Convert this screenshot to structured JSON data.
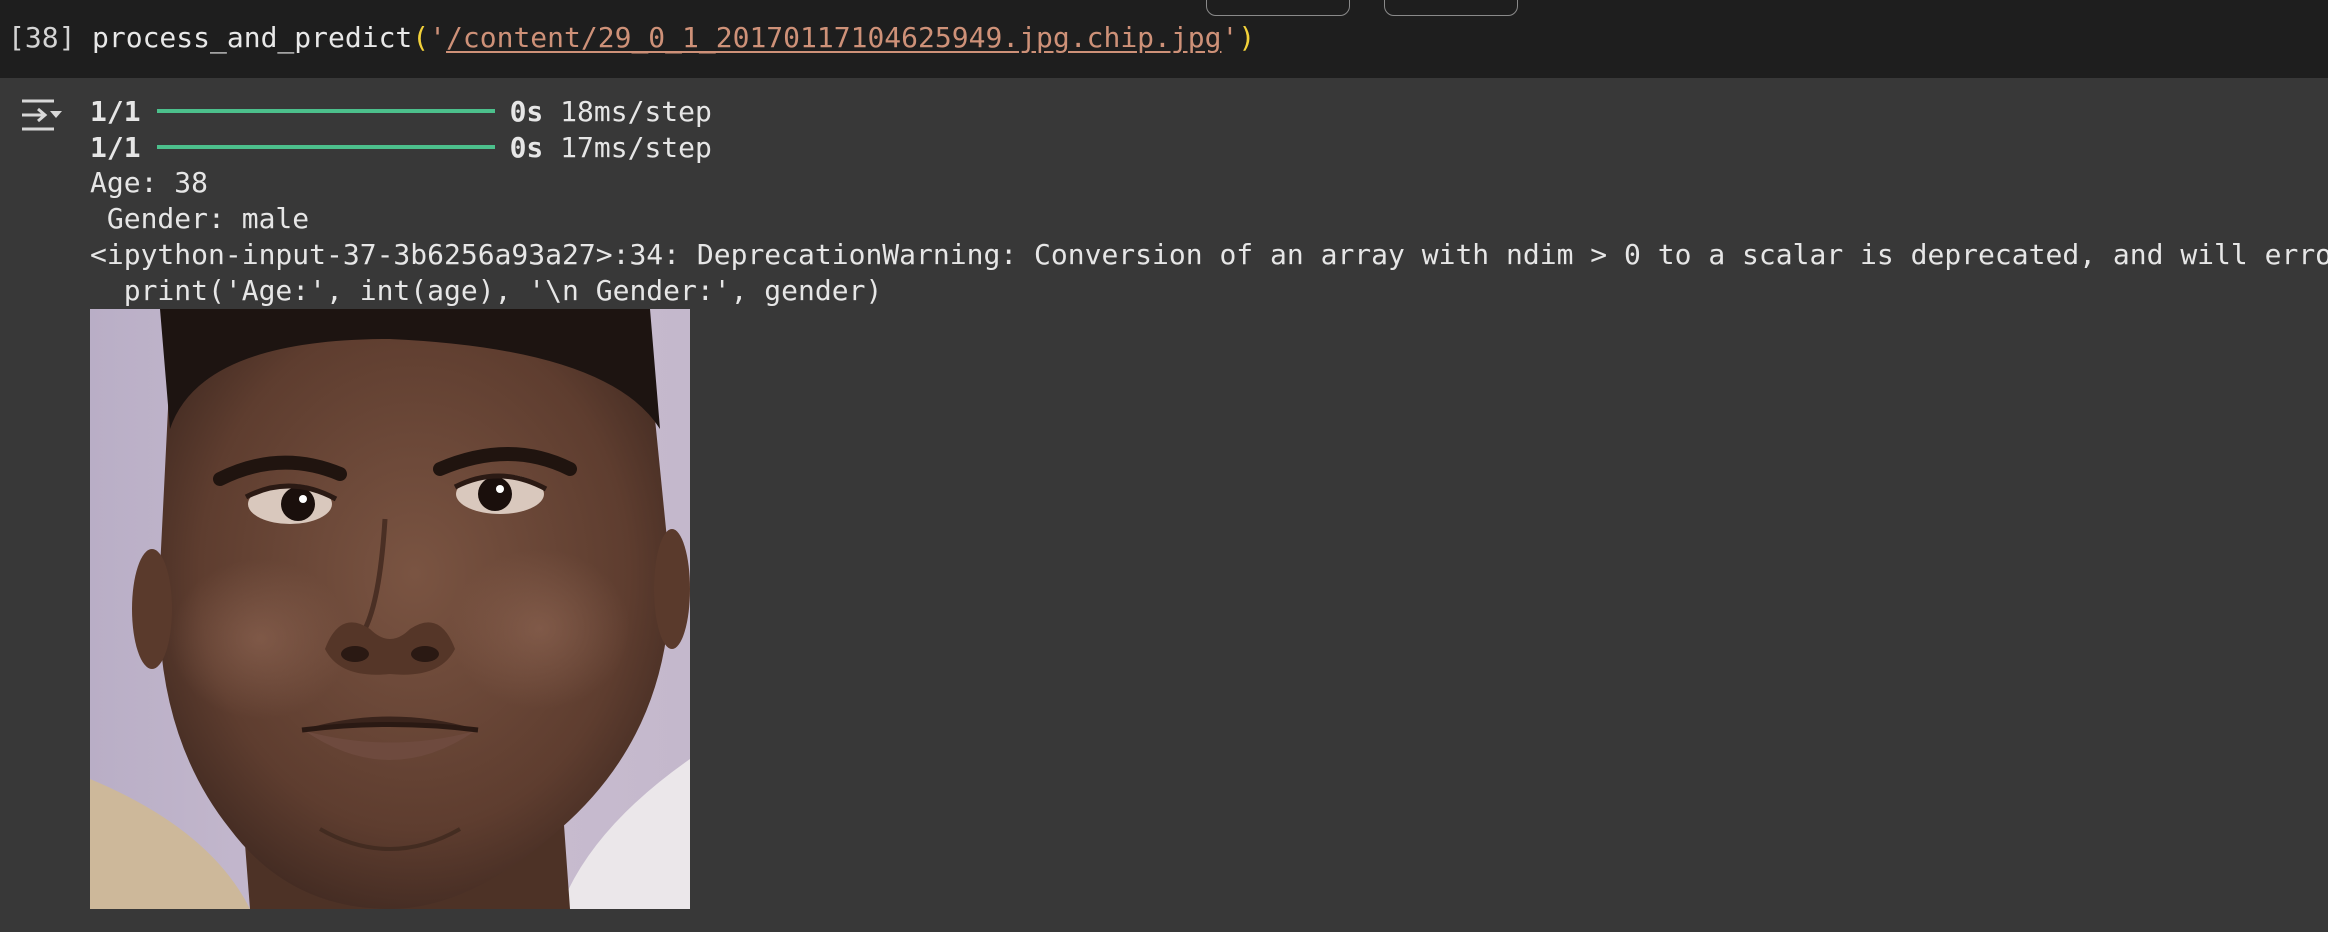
{
  "cell": {
    "execution_count": "[38]",
    "code": {
      "function": "process_and_predict",
      "open_paren": "(",
      "quote_open": "'",
      "path": "/content/29_0_1_20170117104625949.jpg.chip.jpg",
      "quote_close": "'",
      "close_paren": ")"
    }
  },
  "output": {
    "icon": "output-collapse-icon",
    "progress_lines": [
      {
        "step": "1/1",
        "time": "0s",
        "rate": "18ms/step",
        "progress": 1.0
      },
      {
        "step": "1/1",
        "time": "0s",
        "rate": "17ms/step",
        "progress": 1.0
      }
    ],
    "age_line": "Age: 38",
    "gender_line": " Gender: male",
    "warning_line": "<ipython-input-37-3b6256a93a27>:34: DeprecationWarning: Conversion of an array with ndim > 0 to a scalar is deprecated, and will erro",
    "print_line": "  print('Age:', int(age), '\\n Gender:', gender)",
    "image": "face-photo"
  },
  "colors": {
    "cell_background": "#1e1e1e",
    "output_background": "#383838",
    "progress_bar": "#4cc08c",
    "string_literal": "#ce9178",
    "bracket": "#f2d13a"
  }
}
